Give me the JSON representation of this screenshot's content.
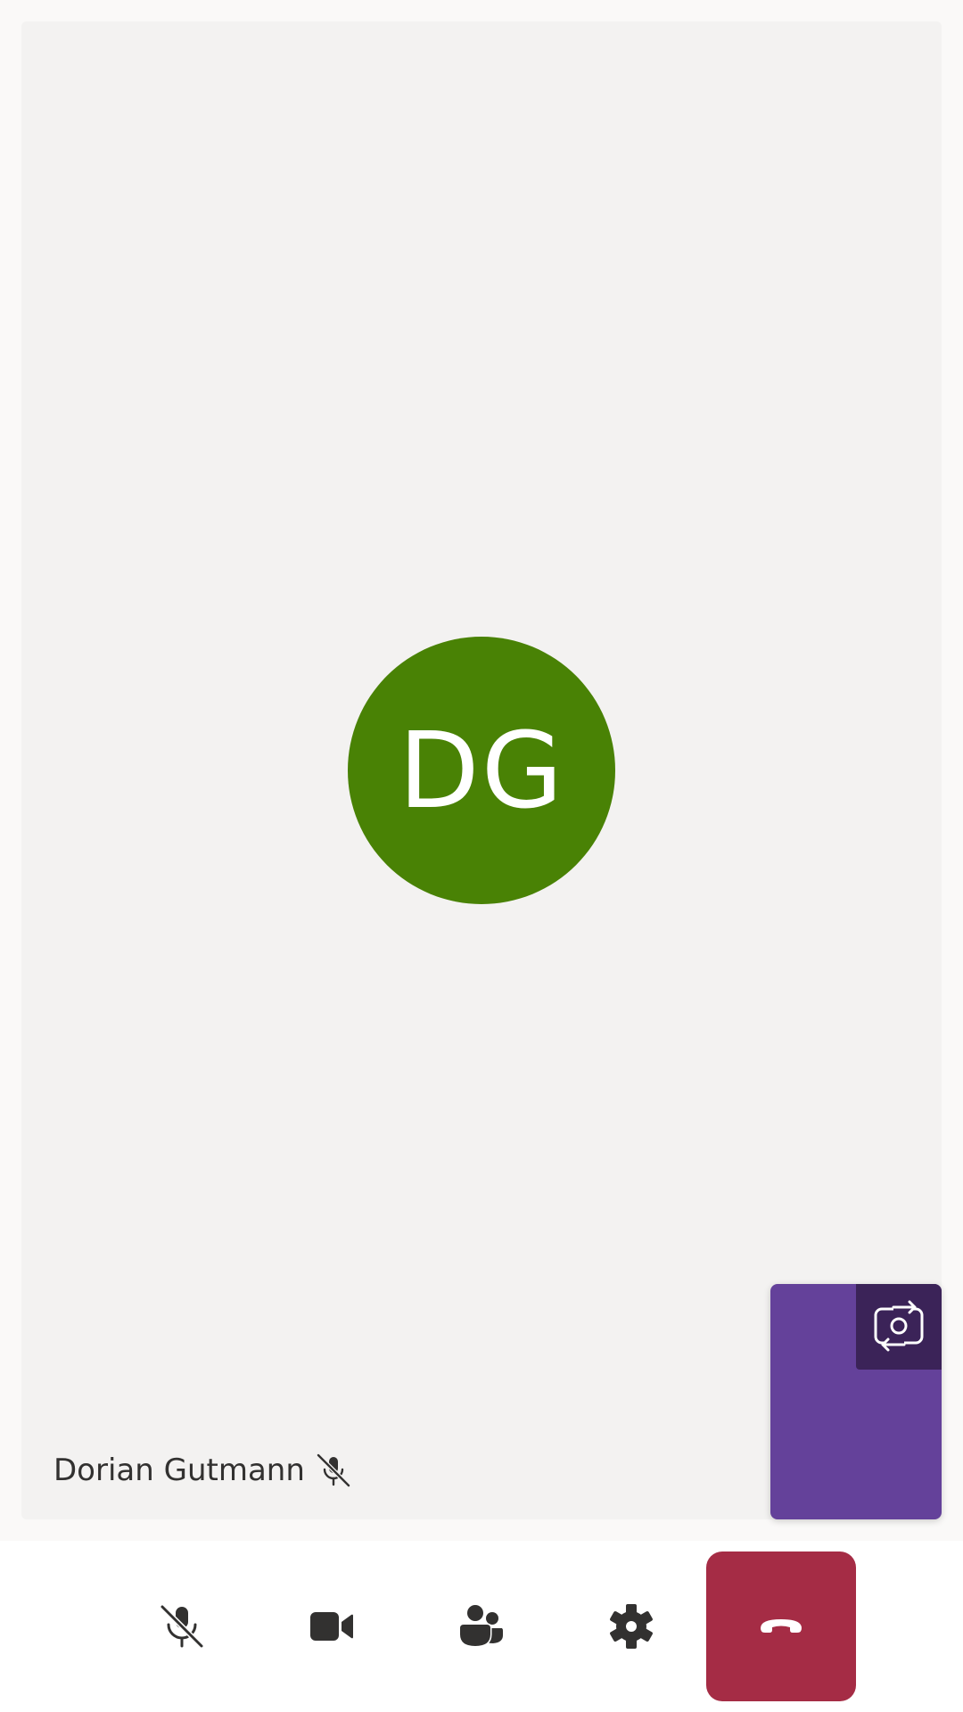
{
  "call": {
    "remote_participant": {
      "initials": "DG",
      "name": "Dorian Gutmann",
      "muted": true,
      "avatar_color": "#498205"
    },
    "self_view": {
      "background_color": "#64419a",
      "switch_camera_icon": "switch-camera-icon"
    }
  },
  "controls": [
    {
      "id": "microphone",
      "icon": "mic-off-icon",
      "state": "muted"
    },
    {
      "id": "camera",
      "icon": "video-camera-icon",
      "state": "on"
    },
    {
      "id": "participants",
      "icon": "people-icon"
    },
    {
      "id": "settings",
      "icon": "gear-icon"
    },
    {
      "id": "hang-up",
      "icon": "hang-up-icon",
      "color": "#a52c45"
    }
  ],
  "colors": {
    "stage_background": "#f3f2f1",
    "page_background": "#faf9f8",
    "icon_color": "#323130",
    "control_bar_background": "#ffffff"
  }
}
